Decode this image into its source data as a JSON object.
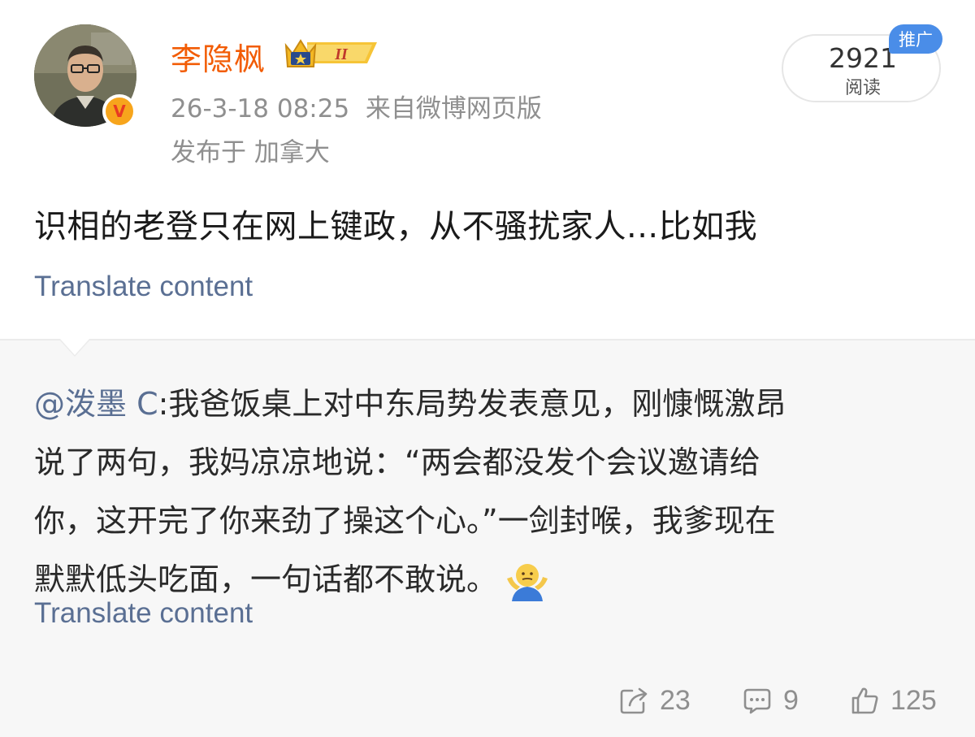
{
  "post": {
    "username": "李隐枫",
    "vip_level": "II",
    "verified_mark": "V",
    "timestamp": "26-3-18 08:25",
    "source": "来自微博网页版",
    "location": "发布于 加拿大",
    "read_count": "2921",
    "read_label": "阅读",
    "ad_tag": "推广",
    "content": "识相的老登只在网上键政，从不骚扰家人...比如我",
    "translate_label": "Translate content"
  },
  "repost": {
    "mention": "@泼墨 C",
    "lines": [
      ":我爸饭桌上对中东局势发表意见，刚慷慨激昂",
      "说了两句，我妈凉凉地说：“两会都没发个会议邀请给",
      "你，这开完了你来劲了操这个心。”一剑封喉，我爹现在",
      "默默低头吃面，一句话都不敢说。"
    ],
    "emoji": "shrug-emoji",
    "translate_label": "Translate content"
  },
  "actions": {
    "share_count": "23",
    "comment_count": "9",
    "like_count": "125"
  },
  "icons": [
    "share-icon",
    "comment-icon",
    "like-icon",
    "verified-icon",
    "vip-crown-icon"
  ],
  "colors": {
    "username": "#f25c05",
    "link": "#5a6f93",
    "meta": "#8f8f8f",
    "ad_tag": "#4a8de8",
    "repost_bg": "#f7f7f7"
  }
}
